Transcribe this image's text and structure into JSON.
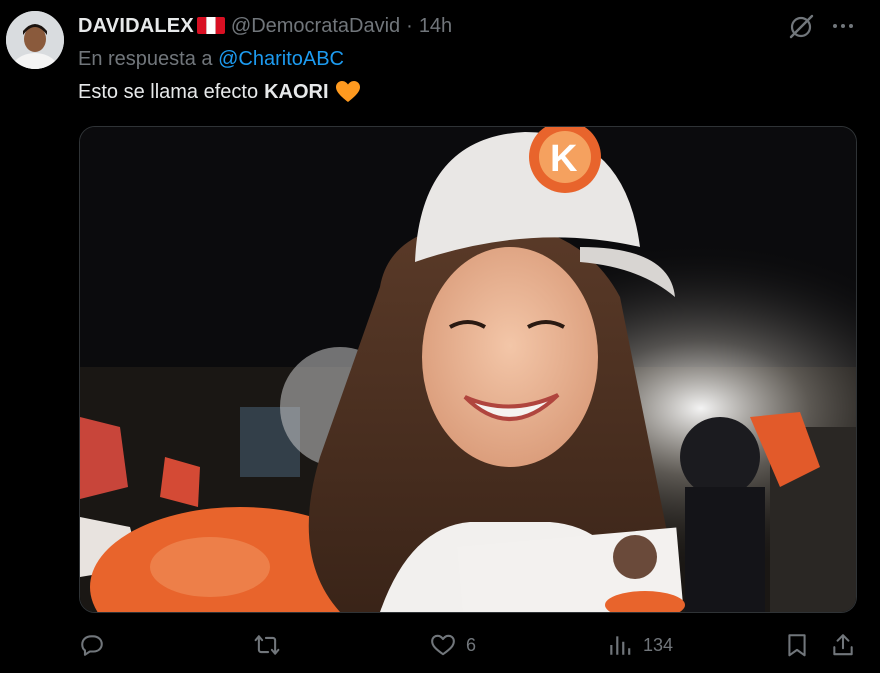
{
  "author": {
    "display_name": "DAVIDALEX",
    "handle": "@DemocrataDavid",
    "separator": "·",
    "time": "14h"
  },
  "reply": {
    "prefix": "En respuesta a",
    "mention": "@CharitoABC"
  },
  "tweet": {
    "text": "Esto se llama efecto",
    "bold": "KAORI"
  },
  "actions": {
    "reply_count": "",
    "retweet_count": "",
    "like_count": "6",
    "views_count": "134"
  },
  "colors": {
    "background": "#000000",
    "text": "#e7e9ea",
    "muted": "#71767b",
    "link": "#1d9bf0",
    "heart_emoji": "#ff9a1f"
  },
  "icons": [
    "grok-icon",
    "more-icon",
    "reply-icon",
    "retweet-icon",
    "like-icon",
    "views-icon",
    "bookmark-icon",
    "share-icon",
    "peru-flag-icon",
    "orange-heart-icon"
  ]
}
